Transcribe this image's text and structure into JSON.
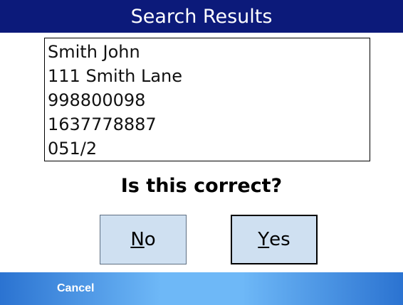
{
  "title": "Search Results",
  "results": [
    "Smith John",
    "111 Smith Lane",
    "998800098",
    "1637778887",
    "051/2"
  ],
  "question": "Is this correct?",
  "buttons": {
    "no_first": "N",
    "no_rest": "o",
    "yes_first": "Y",
    "yes_rest": "es"
  },
  "softkey": {
    "left": "Cancel"
  },
  "colors": {
    "title_bar": "#0c1a7a",
    "button_bg": "#cfe0f1",
    "softbar_edge": "#2b73d1",
    "softbar_center": "#6eb8f7"
  }
}
